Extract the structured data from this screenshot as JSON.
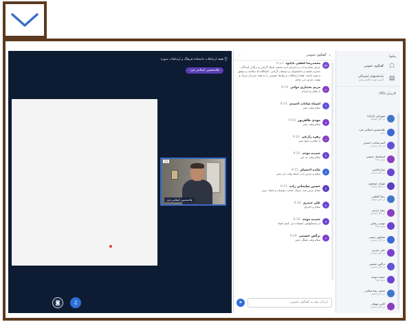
{
  "stage": {
    "meeting_title": "هفته ارتباطات دانشکده فرهنگ و ارتباطات سوره",
    "presenter_badge": "غلامحسین اسلامی فرد",
    "webcam_name": "غلامحسین اسلامی فرد",
    "webcam_number": "23"
  },
  "chat": {
    "title": "گفتگوی عمومی",
    "input_placeholder": "ارسال پیام به گفتگوی عمومی",
    "messages": [
      {
        "author": "محمدرضا لطفی بابایود",
        "time": "9:13",
        "text": "عرض سلام و ادب و احترام دارم محضر استاد گرامی و برگزار کنندگان محترم جلسه و دانشجویان و دوستان گرامی. انشاالله که سلامت و موفق و موید باشید. هفته ارتباطات و روابط عمومی را به همه عزیزان تبریک و تهنیت عرض می نمایم",
        "initial": "مح",
        "color": "#7b4bd1"
      },
      {
        "author": "مریم بختیاری دوانی",
        "time": "9:14",
        "text": "با سلام و احترام",
        "initial": "م",
        "color": "#8a3fbf"
      },
      {
        "author": "اسماء سادات احمدی",
        "time": "9:14",
        "text": "سلام وقت بخیر",
        "initial": "ا",
        "color": "#5f54d6"
      },
      {
        "author": "مهدی طاهرپور",
        "time": "9:14",
        "text": "سلام وقت بخیر",
        "initial": "م",
        "color": "#7c3fcf"
      },
      {
        "author": "زهره زارعی",
        "time": "9:14",
        "text": "با سلام و صبح بخیر",
        "initial": "ز",
        "color": "#8a3fbf"
      },
      {
        "author": "حمیده موحد",
        "time": "9:15",
        "text": "سلام وقت به خیر",
        "initial": "ح",
        "color": "#6a45cf"
      },
      {
        "author": "مائده احتشام",
        "time": "9:15",
        "text": "سلام و عرض ادب استاد وقت تان بخیر",
        "initial": "م",
        "color": "#3c6ad6"
      },
      {
        "author": "حسین سلیمانی زاده",
        "time": "9:15",
        "text": "سلام عرض شد. تبریک خدمت دوستان و استاد عزیز",
        "initial": "ح",
        "color": "#5b3fbf"
      },
      {
        "author": "علی حیدری",
        "time": "9:16",
        "text": "سلام و احترام",
        "initial": "ع",
        "color": "#6a45cf"
      },
      {
        "author": "حمیده موحد",
        "time": "9:16",
        "text": "از سمعکهاتون استفاده می کنیم استاد",
        "initial": "ح",
        "color": "#6a45cf"
      },
      {
        "author": "نرگس حسینی",
        "time": "9:16",
        "text": "سلام وقت همگی بخیر",
        "initial": "ن",
        "color": "#7c3fcf"
      }
    ]
  },
  "sidebar": {
    "heading": "پیامها",
    "public_chat": "گفتگوی عمومی",
    "shared_notes": "یادداشتهای اشتراکی",
    "shared_notes_sub": "آخرین تغییر: دقایقی پیش",
    "users_heading": "کاربران (95)",
    "users": [
      {
        "name": "شهرامی (ارائه)",
        "status": "در حال صحبت",
        "color": "#3f78c9"
      },
      {
        "name": "غلامحسین اسلامی فرد",
        "status": "مدیر",
        "color": "#3c6ad6"
      },
      {
        "name": "آمنه سادات احمدی",
        "status": "در حال شنیدن",
        "color": "#5f54d6"
      },
      {
        "name": "اسماعیل حسینی",
        "status": "بدون صدا",
        "color": "#8a3fbf"
      },
      {
        "name": "سارا فاتحی",
        "status": "در حال شنیدن",
        "color": "#6a45cf"
      },
      {
        "name": "مهران موسوی",
        "status": "در حال شنیدن",
        "color": "#5b3fbf"
      },
      {
        "name": "رضا کاظمی",
        "status": "در حال شنیدن",
        "color": "#3f78c9"
      },
      {
        "name": "زهرا زارعی",
        "status": "در حال شنیدن",
        "color": "#8a3fbf"
      },
      {
        "name": "مهدی رضایی",
        "status": "بدون صدا",
        "color": "#6a45cf"
      },
      {
        "name": "شقایق رحیمی",
        "status": "در حال شنیدن",
        "color": "#3c6ad6"
      },
      {
        "name": "علی حیدری",
        "status": "در حال شنیدن",
        "color": "#7c3fcf"
      },
      {
        "name": "نرگس حسینی",
        "status": "در حال شنیدن",
        "color": "#5f54d6"
      },
      {
        "name": "حمیده موحد",
        "status": "بدون صدا",
        "color": "#6a45cf"
      },
      {
        "name": "محمد رضا صالحی",
        "status": "در حال شنیدن",
        "color": "#3f78c9"
      },
      {
        "name": "کاربر مهمان",
        "status": "در حال شنیدن",
        "color": "#8a3fbf"
      }
    ]
  }
}
